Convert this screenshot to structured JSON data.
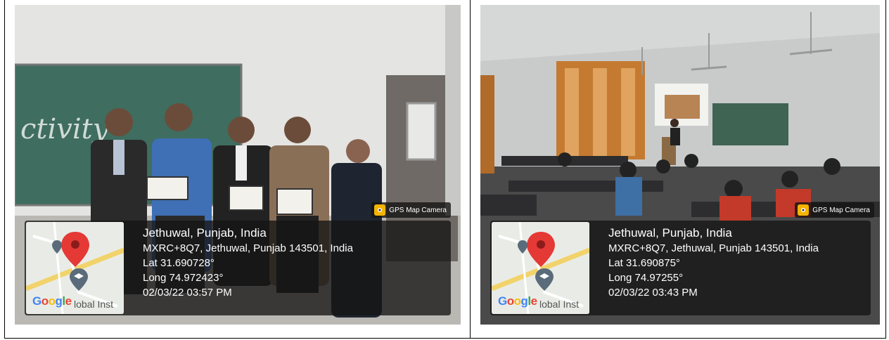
{
  "photos": [
    {
      "place": "Jethuwal, Punjab, India",
      "address": "MXRC+8Q7, Jethuwal, Punjab 143501, India",
      "lat": "Lat 31.690728°",
      "long": "Long 74.972423°",
      "datetime": "02/03/22 03:57 PM",
      "badge": "GPS Map Camera",
      "google": "Google",
      "map_caption": "lobal Inst",
      "board_text": "ctivity"
    },
    {
      "place": "Jethuwal, Punjab, India",
      "address": "MXRC+8Q7, Jethuwal, Punjab 143501, India",
      "lat": "Lat 31.690875°",
      "long": "Long 74.97255°",
      "datetime": "02/03/22 03:43 PM",
      "badge": "GPS Map Camera",
      "google": "Google",
      "map_caption": "lobal Inst"
    }
  ],
  "colors": {
    "overlay": "#141414",
    "pin": "#e53935",
    "chalkboard": "#3e6b5c"
  }
}
